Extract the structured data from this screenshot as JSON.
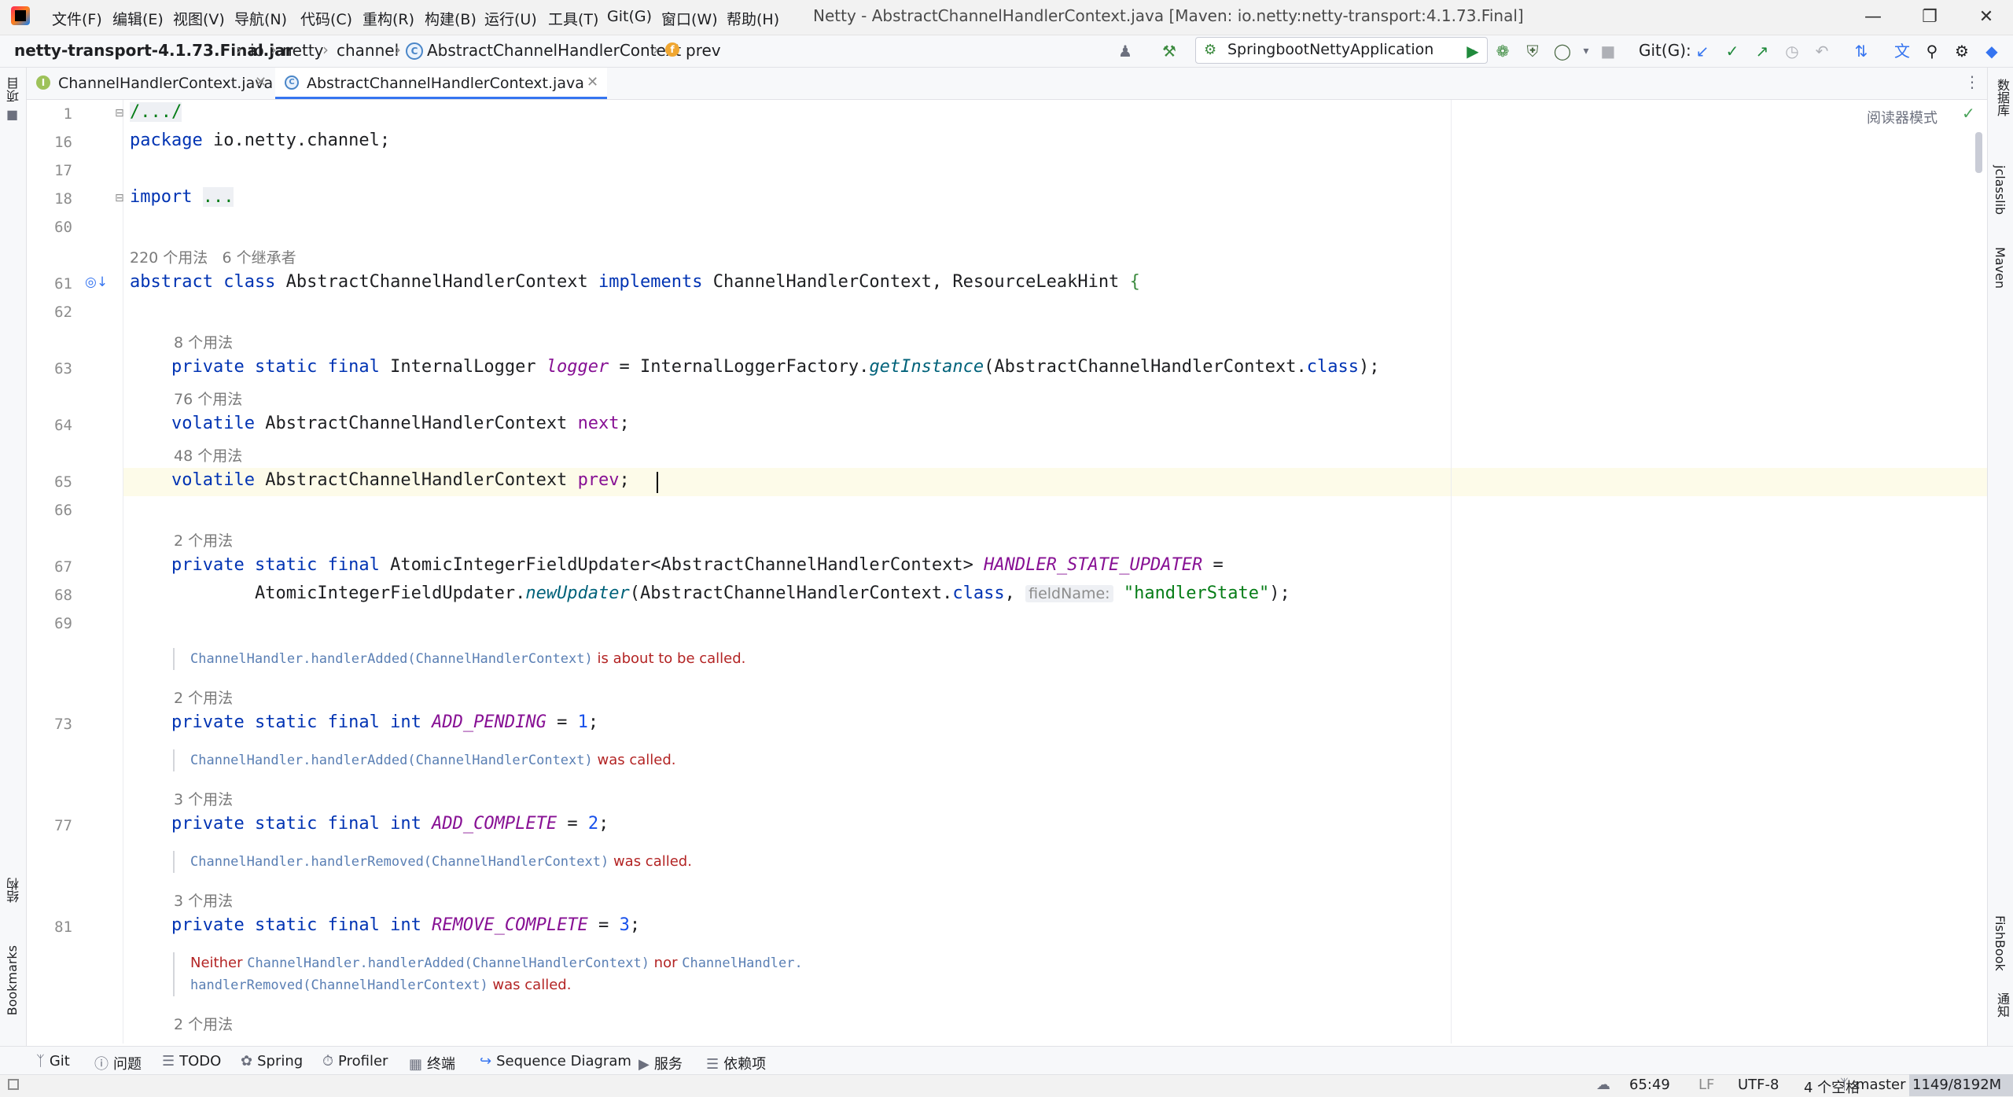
{
  "menu": [
    "文件(F)",
    "编辑(E)",
    "视图(V)",
    "导航(N)",
    "代码(C)",
    "重构(R)",
    "构建(B)",
    "运行(U)",
    "工具(T)",
    "Git(G)",
    "窗口(W)",
    "帮助(H)"
  ],
  "window_title": "Netty - AbstractChannelHandlerContext.java [Maven: io.netty:netty-transport:4.1.73.Final]",
  "breadcrumb": {
    "jar": "netty-transport-4.1.73.Final.jar",
    "p1": "io",
    "p2": "netty",
    "p3": "channel",
    "cls": "AbstractChannelHandlerContext",
    "member": "prev"
  },
  "toolbar": {
    "run_config": "SpringbootNettyApplication",
    "git_label": "Git(G):"
  },
  "tabs": [
    {
      "label": "ChannelHandlerContext.java",
      "icon": "interface-icon",
      "active": false
    },
    {
      "label": "AbstractChannelHandlerContext.java",
      "icon": "class-icon",
      "active": true
    }
  ],
  "left_strip": {
    "project": "项目",
    "structure": "结构",
    "bookmarks": "Bookmarks"
  },
  "right_strip": {
    "database": "数据库",
    "jclasslib": "jclasslib",
    "maven": "Maven",
    "fishbook": "FishBook",
    "notifications": "通知"
  },
  "editor": {
    "reader_mode": "阅读器模式",
    "line_numbers": [
      "1",
      "16",
      "17",
      "18",
      "60",
      "61",
      "62",
      "63",
      "64",
      "65",
      "66",
      "67",
      "68",
      "69",
      "73",
      "77",
      "81"
    ],
    "usages": {
      "class": "220 个用法",
      "inheritors": "6 个继承者",
      "logger": "8 个用法",
      "next": "76 个用法",
      "prev": "48 个用法",
      "updater": "2 个用法",
      "add_pending": "2 个用法",
      "add_complete": "3 个用法",
      "remove_complete": "3 个用法",
      "init": "2 个用法"
    },
    "code": {
      "l1": "/.../",
      "l16_kw": "package",
      "l16_rest": " io.netty.channel;",
      "l18_kw": "import",
      "l18_fold": "...",
      "l61_kw1": "abstract class",
      "l61_name": " AbstractChannelHandlerContext ",
      "l61_kw2": "implements",
      "l61_rest": " ChannelHandlerContext, ResourceLeakHint ",
      "l61_brace": "{",
      "l63_kw": "private static final",
      "l63_type": " InternalLogger ",
      "l63_field": "logger",
      "l63_eq": " = InternalLoggerFactory.",
      "l63_meth": "getInstance",
      "l63_args": "(AbstractChannelHandlerContext.",
      "l63_kw2": "class",
      "l63_end": ");",
      "l64_kw": "volatile",
      "l64_type": " AbstractChannelHandlerContext ",
      "l64_field": "next",
      "l64_end": ";",
      "l65_kw": "volatile",
      "l65_type": " AbstractChannelHandlerContext ",
      "l65_field": "prev",
      "l65_end": ";",
      "l67_kw": "private static final",
      "l67_type": " AtomicIntegerFieldUpdater<AbstractChannelHandlerContext> ",
      "l67_field": "HANDLER_STATE_UPDATER",
      "l67_eq": " =",
      "l68_a": "AtomicIntegerFieldUpdater.",
      "l68_meth": "newUpdater",
      "l68_args": "(AbstractChannelHandlerContext.",
      "l68_kw": "class",
      "l68_comma": ", ",
      "l68_hint": "fieldName:",
      "l68_str": "\"handlerState\"",
      "l68_end": ");",
      "l73_kw": "private static final int",
      "l73_field": "ADD_PENDING",
      "l73_eq": " = ",
      "l73_num": "1",
      "l73_end": ";",
      "l77_kw": "private static final int",
      "l77_field": "ADD_COMPLETE",
      "l77_eq": " = ",
      "l77_num": "2",
      "l77_end": ";",
      "l81_kw": "private static final int",
      "l81_field": "REMOVE_COMPLETE",
      "l81_eq": " = ",
      "l81_num": "3",
      "l81_end": ";"
    },
    "docs": {
      "d1_code": "ChannelHandler.handlerAdded(ChannelHandlerContext)",
      "d1_text": " is about to be called.",
      "d2_code": "ChannelHandler.handlerAdded(ChannelHandlerContext)",
      "d2_text": " was called.",
      "d3_code": "ChannelHandler.handlerRemoved(ChannelHandlerContext)",
      "d3_text": " was called.",
      "d4_a": "Neither ",
      "d4_code1": "ChannelHandler.handlerAdded(ChannelHandlerContext)",
      "d4_b": " nor ",
      "d4_code2": "ChannelHandler.",
      "d4_code3": "handlerRemoved(ChannelHandlerContext)",
      "d4_c": " was called."
    }
  },
  "tool_windows": [
    {
      "label": "Git",
      "icon": "git-icon"
    },
    {
      "label": "问题",
      "icon": "problems-icon"
    },
    {
      "label": "TODO",
      "icon": "todo-icon"
    },
    {
      "label": "Spring",
      "icon": "spring-icon"
    },
    {
      "label": "Profiler",
      "icon": "profiler-icon"
    },
    {
      "label": "终端",
      "icon": "terminal-icon"
    },
    {
      "label": "Sequence Diagram",
      "icon": "sequence-diagram-icon"
    },
    {
      "label": "服务",
      "icon": "services-icon"
    },
    {
      "label": "依赖项",
      "icon": "dependencies-icon"
    }
  ],
  "status": {
    "position": "65:49",
    "line_sep": "LF",
    "encoding": "UTF-8",
    "indent": "4 个空格",
    "branch": "master",
    "memory": "1149/8192M"
  }
}
